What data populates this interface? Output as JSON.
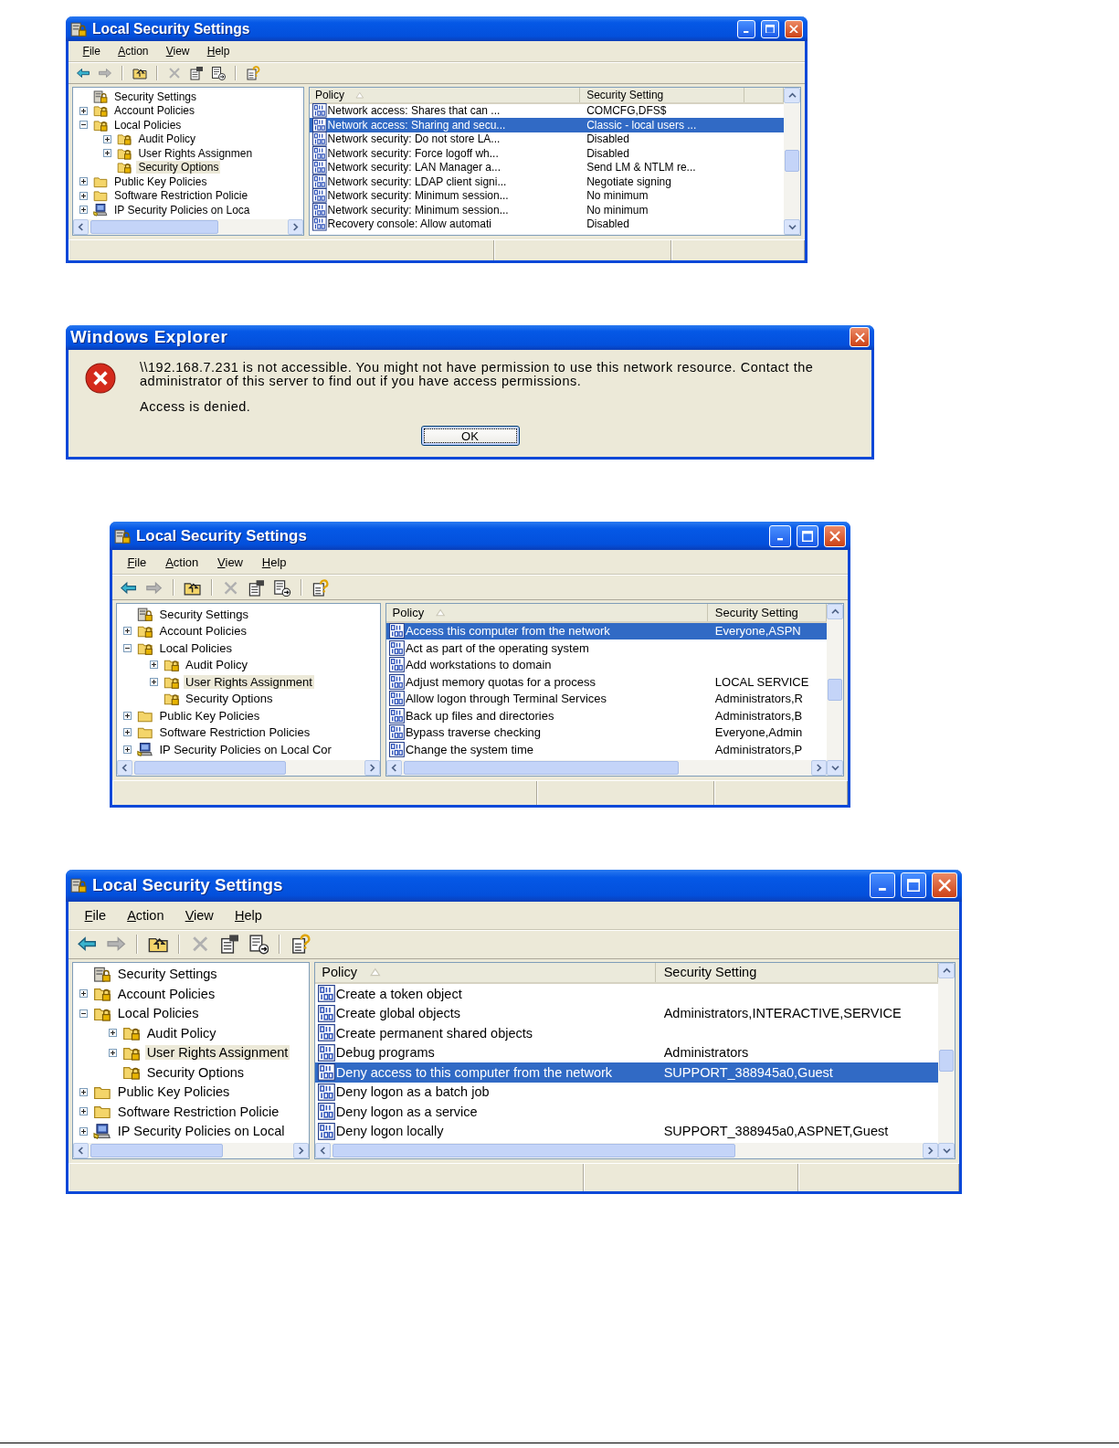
{
  "figures": [
    {
      "kind": "mmc",
      "title": "Local Security Settings",
      "menu": [
        "File",
        "Action",
        "View",
        "Help"
      ],
      "toolbar": [
        {
          "kind": "back",
          "disabled": false
        },
        {
          "kind": "forward",
          "disabled": true
        },
        {
          "kind": "separator"
        },
        {
          "kind": "up",
          "disabled": false
        },
        {
          "kind": "separator"
        },
        {
          "kind": "delete",
          "disabled": true
        },
        {
          "kind": "properties",
          "disabled": false
        },
        {
          "kind": "export",
          "disabled": false
        },
        {
          "kind": "separator"
        },
        {
          "kind": "help",
          "disabled": false
        }
      ],
      "tree": [
        {
          "label": "Security Settings",
          "kind": "root",
          "expandable": false,
          "selected": false,
          "children": [
            {
              "label": "Account Policies",
              "kind": "locked-folder",
              "expandable": true,
              "expanded": false,
              "selected": false
            },
            {
              "label": "Local Policies",
              "kind": "locked-folder",
              "expandable": true,
              "expanded": true,
              "selected": false,
              "children": [
                {
                  "label": "Audit Policy",
                  "kind": "locked-folder",
                  "expandable": true,
                  "expanded": false,
                  "selected": false
                },
                {
                  "label": "User Rights Assignmen",
                  "kind": "locked-folder",
                  "expandable": true,
                  "expanded": false,
                  "selected": false
                },
                {
                  "label": "Security Options",
                  "kind": "locked-folder",
                  "expandable": false,
                  "selected": true
                }
              ]
            },
            {
              "label": "Public Key Policies",
              "kind": "folder",
              "expandable": true,
              "expanded": false,
              "selected": false
            },
            {
              "label": "Software Restriction Policie",
              "kind": "folder",
              "expandable": true,
              "expanded": false,
              "selected": false
            },
            {
              "label": "IP Security Policies on Loca",
              "kind": "computer",
              "expandable": true,
              "expanded": false,
              "selected": false
            }
          ]
        }
      ],
      "columns": [
        {
          "label": "Policy",
          "sorted": true
        },
        {
          "label": "Security Setting",
          "sorted": false
        },
        {
          "sorted": false
        }
      ],
      "rows": [
        {
          "policy": "Network access: Shares that can ...",
          "setting": "COMCFG,DFS$",
          "selected": false
        },
        {
          "policy": "Network access: Sharing and secu...",
          "setting": "Classic - local users ...",
          "selected": true
        },
        {
          "policy": "Network security: Do not store LA...",
          "setting": "Disabled",
          "selected": false
        },
        {
          "policy": "Network security: Force logoff wh...",
          "setting": "Disabled",
          "selected": false
        },
        {
          "policy": "Network security: LAN Manager a...",
          "setting": "Send LM & NTLM re...",
          "selected": false
        },
        {
          "policy": "Network security: LDAP client signi...",
          "setting": "Negotiate signing",
          "selected": false
        },
        {
          "policy": "Network security: Minimum session...",
          "setting": "No minimum",
          "selected": false
        },
        {
          "policy": "Network security: Minimum session...",
          "setting": "No minimum",
          "selected": false
        },
        {
          "policy": "Recovery console: Allow automati",
          "setting": "Disabled",
          "selected": false
        }
      ],
      "list_hscroll": false
    },
    {
      "kind": "dialog",
      "title": "Windows Explorer",
      "message": [
        "\\\\192.168.7.231 is not accessible. You might not have permission to use this network resource. Contact the administrator of this server to find out if you have access permissions.",
        "Access is denied."
      ],
      "buttons": [
        {
          "label": "OK",
          "focused": true
        }
      ]
    },
    {
      "kind": "mmc",
      "title": "Local Security Settings",
      "menu": [
        "File",
        "Action",
        "View",
        "Help"
      ],
      "toolbar": [
        {
          "kind": "back",
          "disabled": false
        },
        {
          "kind": "forward",
          "disabled": true
        },
        {
          "kind": "separator"
        },
        {
          "kind": "up",
          "disabled": false
        },
        {
          "kind": "separator"
        },
        {
          "kind": "delete",
          "disabled": true
        },
        {
          "kind": "properties",
          "disabled": false
        },
        {
          "kind": "export",
          "disabled": false
        },
        {
          "kind": "separator"
        },
        {
          "kind": "help",
          "disabled": false
        }
      ],
      "tree": [
        {
          "label": "Security Settings",
          "kind": "root",
          "expandable": false,
          "selected": false,
          "children": [
            {
              "label": "Account Policies",
              "kind": "locked-folder",
              "expandable": true,
              "expanded": false,
              "selected": false
            },
            {
              "label": "Local Policies",
              "kind": "locked-folder",
              "expandable": true,
              "expanded": true,
              "selected": false,
              "children": [
                {
                  "label": "Audit Policy",
                  "kind": "locked-folder",
                  "expandable": true,
                  "expanded": false,
                  "selected": false
                },
                {
                  "label": "User Rights Assignment",
                  "kind": "locked-folder",
                  "expandable": true,
                  "expanded": false,
                  "selected": true
                },
                {
                  "label": "Security Options",
                  "kind": "locked-folder",
                  "expandable": false,
                  "selected": false
                }
              ]
            },
            {
              "label": "Public Key Policies",
              "kind": "folder",
              "expandable": true,
              "expanded": false,
              "selected": false
            },
            {
              "label": "Software Restriction Policies",
              "kind": "folder",
              "expandable": true,
              "expanded": false,
              "selected": false
            },
            {
              "label": "IP Security Policies on Local Cor",
              "kind": "computer",
              "expandable": true,
              "expanded": false,
              "selected": false
            }
          ]
        }
      ],
      "columns": [
        {
          "label": "Policy",
          "sorted": true
        },
        {
          "label": "Security Setting",
          "sorted": false
        }
      ],
      "rows": [
        {
          "policy": "Access this computer from the network",
          "setting": "Everyone,ASPN",
          "selected": true
        },
        {
          "policy": "Act as part of the operating system",
          "selected": false
        },
        {
          "policy": "Add workstations to domain",
          "selected": false
        },
        {
          "policy": "Adjust memory quotas for a process",
          "setting": "LOCAL SERVICE",
          "selected": false
        },
        {
          "policy": "Allow logon through Terminal Services",
          "setting": "Administrators,R",
          "selected": false
        },
        {
          "policy": "Back up files and directories",
          "setting": "Administrators,B",
          "selected": false
        },
        {
          "policy": "Bypass traverse checking",
          "setting": "Everyone,Admin",
          "selected": false
        },
        {
          "policy": "Change the system time",
          "setting": "Administrators,P",
          "selected": false
        }
      ],
      "list_hscroll": true
    },
    {
      "kind": "mmc",
      "title": "Local Security Settings",
      "menu": [
        "File",
        "Action",
        "View",
        "Help"
      ],
      "toolbar": [
        {
          "kind": "back",
          "disabled": false
        },
        {
          "kind": "forward",
          "disabled": true
        },
        {
          "kind": "separator"
        },
        {
          "kind": "up",
          "disabled": false
        },
        {
          "kind": "separator"
        },
        {
          "kind": "delete",
          "disabled": true
        },
        {
          "kind": "properties",
          "disabled": false
        },
        {
          "kind": "export",
          "disabled": false
        },
        {
          "kind": "separator"
        },
        {
          "kind": "help",
          "disabled": false
        }
      ],
      "tree": [
        {
          "label": "Security Settings",
          "kind": "root",
          "expandable": false,
          "selected": false,
          "children": [
            {
              "label": "Account Policies",
              "kind": "locked-folder",
              "expandable": true,
              "expanded": false,
              "selected": false
            },
            {
              "label": "Local Policies",
              "kind": "locked-folder",
              "expandable": true,
              "expanded": true,
              "selected": false,
              "children": [
                {
                  "label": "Audit Policy",
                  "kind": "locked-folder",
                  "expandable": true,
                  "expanded": false,
                  "selected": false
                },
                {
                  "label": "User Rights Assignment",
                  "kind": "locked-folder",
                  "expandable": true,
                  "expanded": false,
                  "selected": true
                },
                {
                  "label": "Security Options",
                  "kind": "locked-folder",
                  "expandable": false,
                  "selected": false
                }
              ]
            },
            {
              "label": "Public Key Policies",
              "kind": "folder",
              "expandable": true,
              "expanded": false,
              "selected": false
            },
            {
              "label": "Software Restriction Policie",
              "kind": "folder",
              "expandable": true,
              "expanded": false,
              "selected": false
            },
            {
              "label": "IP Security Policies on Local",
              "kind": "computer",
              "expandable": true,
              "expanded": false,
              "selected": false
            }
          ]
        }
      ],
      "columns": [
        {
          "label": "Policy",
          "sorted": true
        },
        {
          "label": "Security Setting",
          "sorted": false
        }
      ],
      "rows": [
        {
          "policy": "Create a token object",
          "selected": false
        },
        {
          "policy": "Create global objects",
          "setting": "Administrators,INTERACTIVE,SERVICE",
          "selected": false
        },
        {
          "policy": "Create permanent shared objects",
          "selected": false
        },
        {
          "policy": "Debug programs",
          "setting": "Administrators",
          "selected": false
        },
        {
          "policy": "Deny access to this computer from the network",
          "setting": "SUPPORT_388945a0,Guest",
          "selected": true
        },
        {
          "policy": "Deny logon as a batch job",
          "selected": false
        },
        {
          "policy": "Deny logon as a service",
          "selected": false
        },
        {
          "policy": "Deny logon locally",
          "setting": "SUPPORT_388945a0,ASPNET,Guest",
          "selected": false
        }
      ],
      "list_hscroll": true
    }
  ]
}
